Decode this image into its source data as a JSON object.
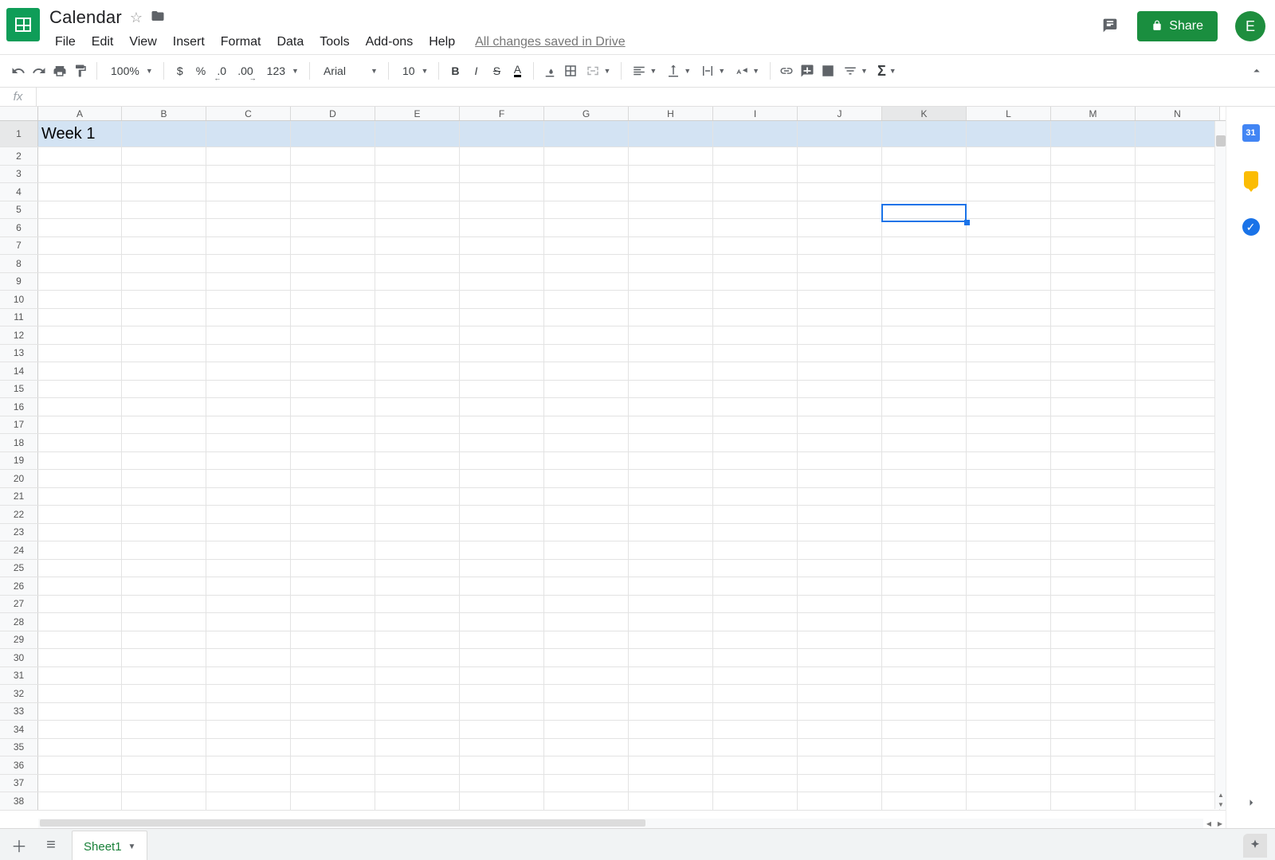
{
  "doc": {
    "title": "Calendar",
    "save_status": "All changes saved in Drive"
  },
  "menus": {
    "file": "File",
    "edit": "Edit",
    "view": "View",
    "insert": "Insert",
    "format": "Format",
    "data": "Data",
    "tools": "Tools",
    "addons": "Add-ons",
    "help": "Help"
  },
  "share": {
    "label": "Share"
  },
  "avatar": {
    "initial": "E"
  },
  "toolbar": {
    "zoom": "100%",
    "currency": "$",
    "percent": "%",
    "dec_minus": ".0",
    "dec_plus": ".00",
    "numfmt": "123",
    "font": "Arial",
    "size": "10"
  },
  "formula": {
    "fx": "fx",
    "value": ""
  },
  "columns": [
    "A",
    "B",
    "C",
    "D",
    "E",
    "F",
    "G",
    "H",
    "I",
    "J",
    "K",
    "L",
    "M",
    "N"
  ],
  "active_column": "K",
  "rows": {
    "count": 38,
    "first_row_height": 33,
    "default_height": 22.5,
    "highlighted_row": 1,
    "active_cell": {
      "col": "K",
      "row": 5
    }
  },
  "cells": {
    "A1": "Week 1"
  },
  "sheet_tabs": {
    "active": "Sheet1"
  },
  "sidepanel": {
    "calendar_day": "31"
  }
}
